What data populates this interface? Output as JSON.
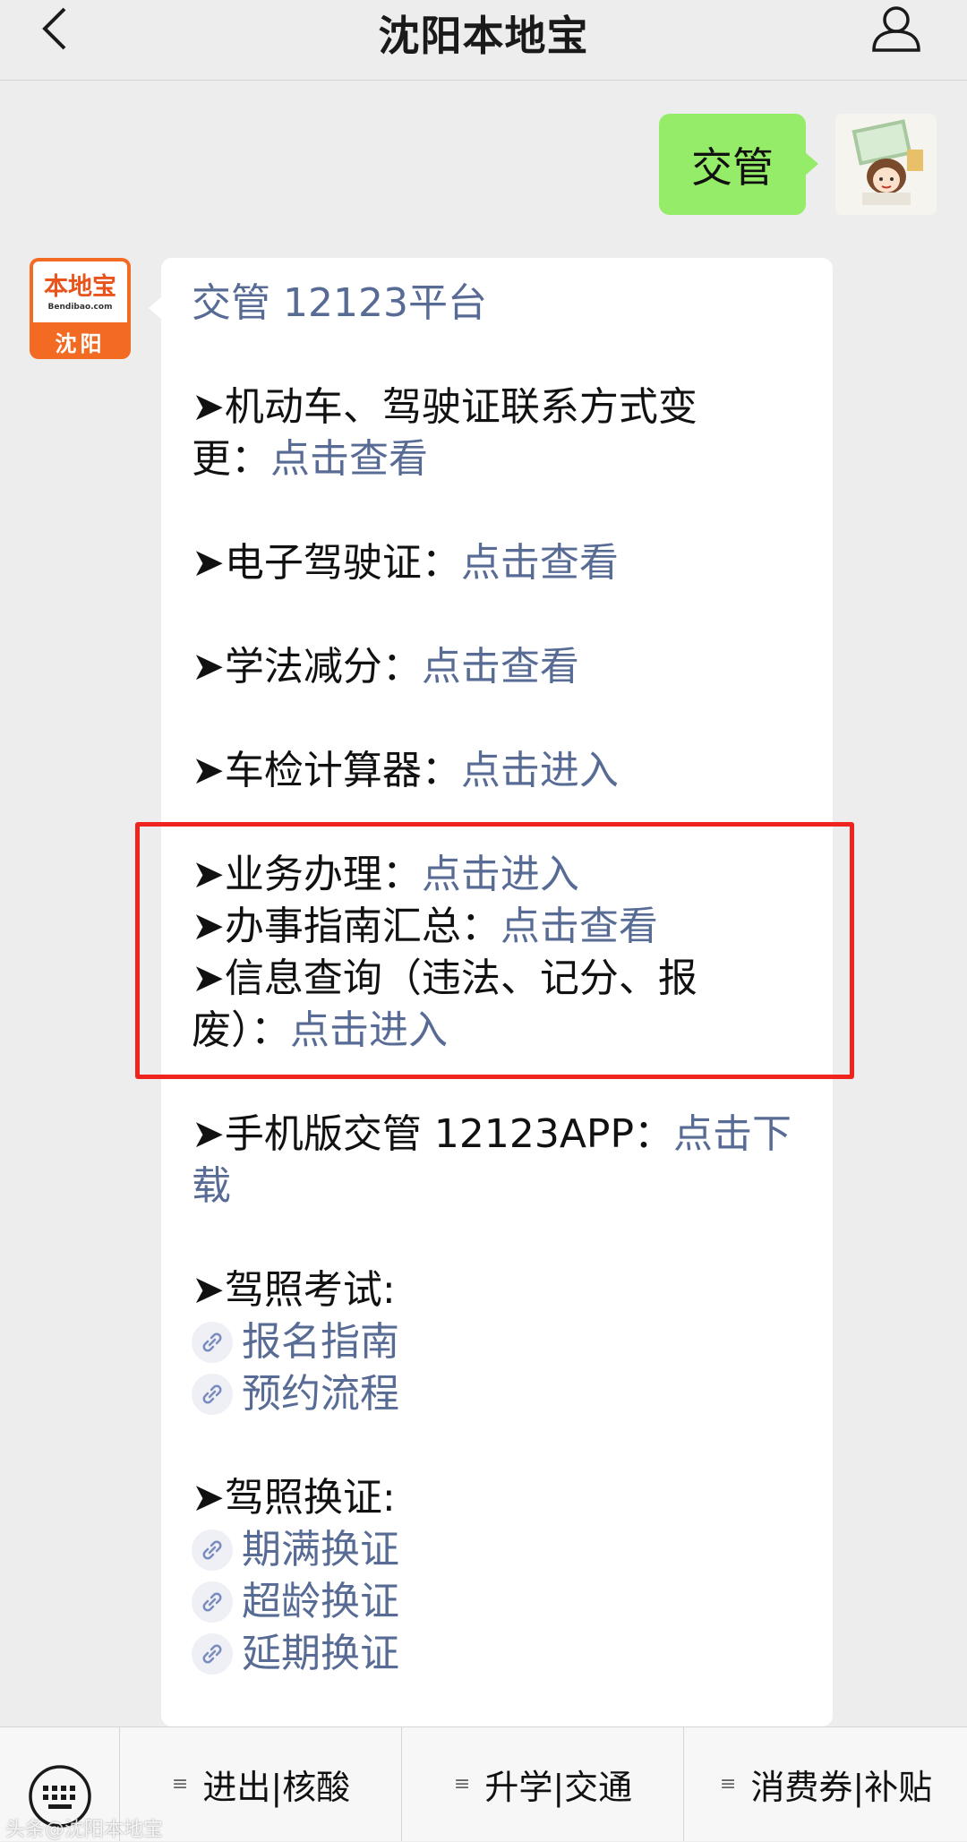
{
  "nav": {
    "title": "沈阳本地宝"
  },
  "outgoing": {
    "text": "交管"
  },
  "bot": {
    "logo": "本地宝",
    "domain": "Bendibao.com",
    "city": "沈阳"
  },
  "message": {
    "heading": "交管 12123平台",
    "items": [
      {
        "prefix": "➤机动车、驾驶证联系方式变",
        "prefix2": "更：",
        "link": "点击查看"
      },
      {
        "prefix": "➤电子驾驶证：",
        "link": "点击查看"
      },
      {
        "prefix": "➤学法减分：",
        "link": "点击查看"
      },
      {
        "prefix": "➤车检计算器：",
        "link": "点击进入"
      },
      {
        "prefix": "➤业务办理：",
        "link": "点击进入"
      },
      {
        "prefix": "➤办事指南汇总：",
        "link": "点击查看"
      },
      {
        "prefix": "➤信息查询（违法、记分、报",
        "prefix2": "废）：",
        "link": "点击进入"
      },
      {
        "prefix": "➤手机版交管 12123APP：",
        "link": "点击下",
        "link2": "载"
      }
    ],
    "exam": {
      "title": "➤驾照考试:",
      "links": [
        "报名指南",
        "预约流程"
      ]
    },
    "renew": {
      "title": "➤驾照换证:",
      "links": [
        "期满换证",
        "超龄换证",
        "延期换证"
      ]
    }
  },
  "bottom_menu": [
    "进出|核酸",
    "升学|交通",
    "消费券|补贴"
  ],
  "watermark": "头条@沈阳本地宝"
}
